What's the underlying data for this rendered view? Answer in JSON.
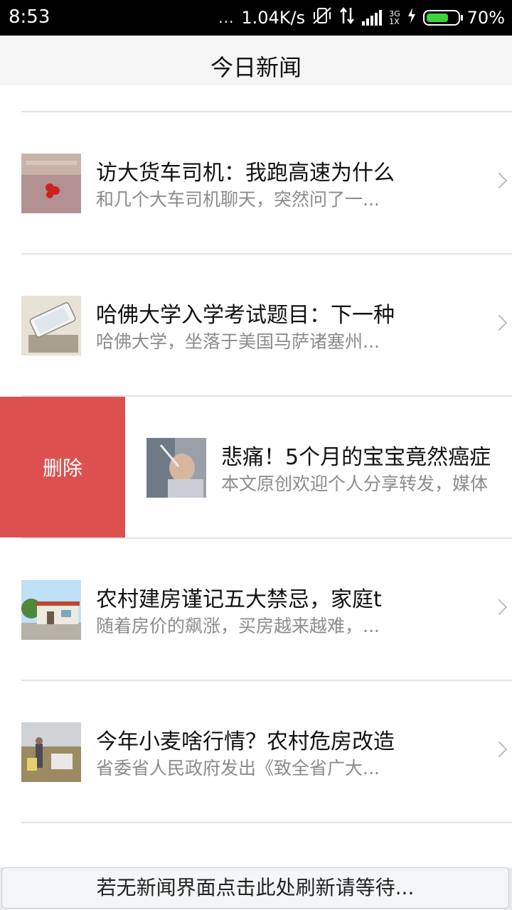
{
  "status_bar": {
    "time": "8:53",
    "dots": "...",
    "speed": "1.04K/s",
    "network_top": "3G",
    "network_bottom": "1X",
    "battery": "70%",
    "battery_level": 0.7,
    "battery_color": "#3bd43b"
  },
  "header": {
    "title": "今日新闻"
  },
  "news": [
    {
      "headline": "访大货车司机：我跑高速为什么",
      "summary": "和几个大车司机聊天，突然问了一...",
      "thumb_icon": "china-unicom-storefront-image"
    },
    {
      "headline": "哈佛大学入学考试题目：下一种",
      "summary": "哈佛大学，坐落于美国马萨诸塞州...",
      "thumb_icon": "phone-on-paper-image"
    },
    {
      "headline": "悲痛！5个月的宝宝竟然癌症",
      "summary": "本文原创欢迎个人分享转发，媒体",
      "thumb_icon": "baby-in-hospital-image"
    },
    {
      "headline": "农村建房谨记五大禁忌，家庭t",
      "summary": "随着房价的飙涨，买房越来越难，...",
      "thumb_icon": "rural-house-image"
    },
    {
      "headline": "今年小麦啥行情？农村危房改造",
      "summary": "省委省人民政府发出《致全省广大...",
      "thumb_icon": "wheat-field-workers-image"
    }
  ],
  "swipe_action": {
    "delete_label": "删除",
    "color": "#dc5150"
  },
  "footer": {
    "refresh_text": "若无新闻界面点击此处刷新请等待..."
  }
}
